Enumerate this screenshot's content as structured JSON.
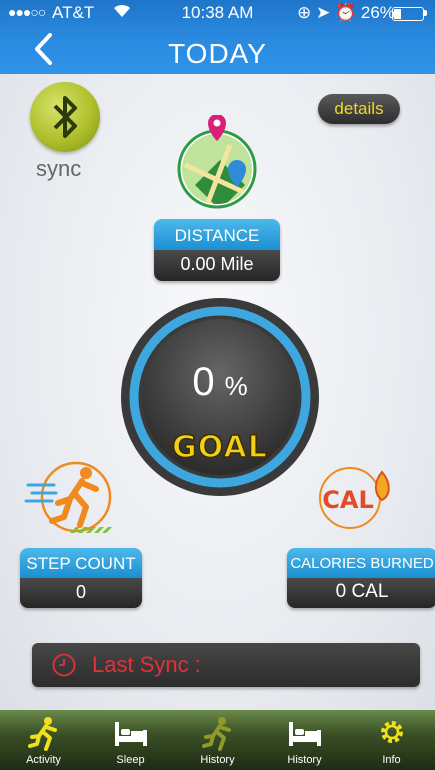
{
  "status_bar": {
    "signal": "●●●○○",
    "carrier": "AT&T",
    "time": "10:38 AM",
    "battery": "26%",
    "battery_level": 0.26
  },
  "header": {
    "title": "TODAY"
  },
  "sync": {
    "label": "sync"
  },
  "details": {
    "label": "details"
  },
  "distance": {
    "label": "DISTANCE",
    "value": "0.00  Mile"
  },
  "goal": {
    "percent": "0",
    "percent_sign": "%",
    "label": "GOAL"
  },
  "steps": {
    "label": "STEP COUNT",
    "value": "0"
  },
  "calories": {
    "label": "CALORIES BURNED",
    "value": "0  CAL",
    "icon_text": "CAL"
  },
  "last_sync": {
    "label": "Last Sync :"
  },
  "tabs": [
    {
      "label": "Activity",
      "icon": "runner-icon"
    },
    {
      "label": "Sleep",
      "icon": "bed-icon"
    },
    {
      "label": "History",
      "icon": "runner-icon"
    },
    {
      "label": "History",
      "icon": "bed-icon"
    },
    {
      "label": "Info",
      "icon": "gear-icon"
    }
  ],
  "colors": {
    "header_blue": "#2a8be0",
    "accent_yellow": "#f1d81f",
    "sync_red": "#e3313a",
    "label_blue": "#1b8fd2",
    "tab_green": "#3a5026"
  }
}
